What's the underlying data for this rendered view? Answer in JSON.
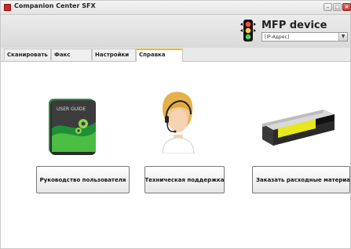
{
  "window": {
    "title": "Companion Center SFX",
    "controls": {
      "minimize": "–",
      "maximize": "□",
      "close": "×"
    }
  },
  "header": {
    "device_title": "MFP device",
    "ip_select": {
      "value": "[IP-Адрес]"
    },
    "icons": {
      "device_status": "traffic-light-icon"
    }
  },
  "tabs": [
    {
      "label": "Сканировать",
      "active": false
    },
    {
      "label": "Факс",
      "active": false
    },
    {
      "label": "Настройки",
      "active": false
    },
    {
      "label": "Справка",
      "active": true
    }
  ],
  "help": {
    "images": {
      "user_guide": {
        "icon": "user-guide-book-icon",
        "cover_text": "USER GUIDE"
      },
      "support": {
        "icon": "support-operator-icon"
      },
      "supplies": {
        "icon": "toner-cartridge-icon"
      }
    },
    "buttons": {
      "manual": "Руководство пользователя",
      "support": "Техническая поддержка",
      "supplies": "Заказать расходные материалы"
    }
  },
  "colors": {
    "active_tab_accent": "#f1b81c",
    "close_button": "#c8302c",
    "book_green": "#2f8d41",
    "toner_yellow": "#e7e61f"
  }
}
